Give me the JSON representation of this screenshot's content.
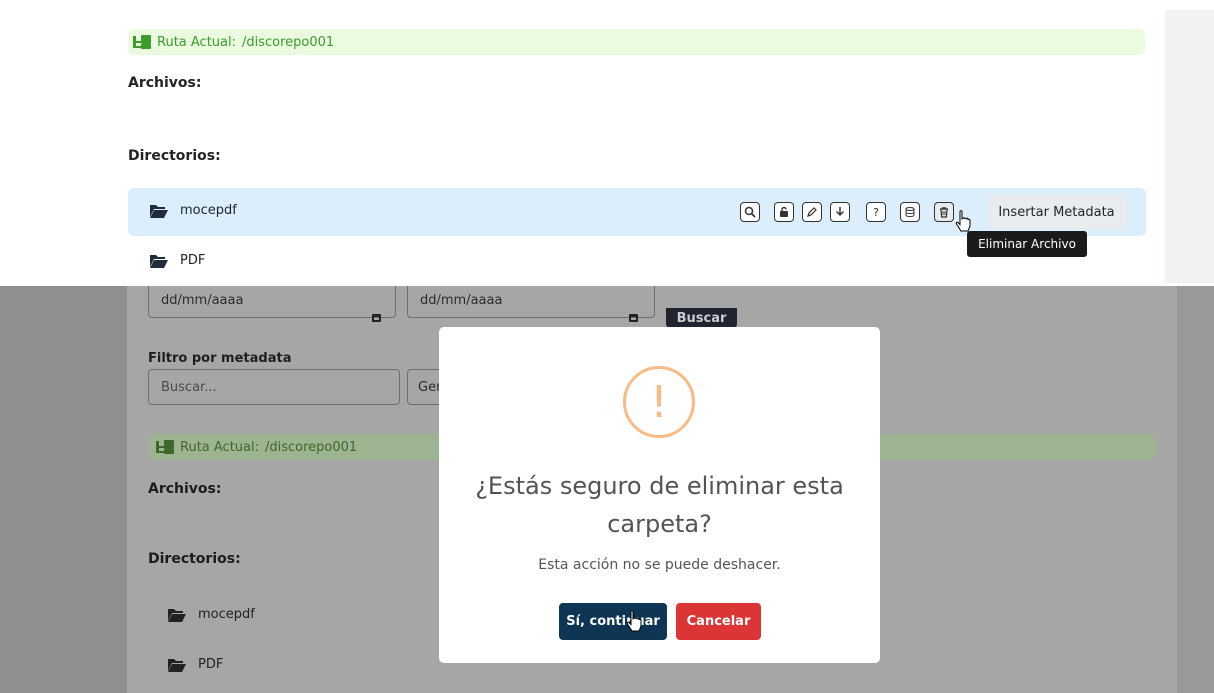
{
  "top": {
    "ruta_label": "Ruta Actual:",
    "ruta_path": "/discorepo001",
    "archivos_heading": "Archivos:",
    "directorios_heading": "Directorios:",
    "directories": [
      {
        "name": "mocepdf",
        "icon": "folder-open-icon"
      },
      {
        "name": "PDF",
        "icon": "folder-open-icon"
      }
    ],
    "actions": [
      {
        "icon": "search-file-icon"
      },
      {
        "icon": "lock-icon"
      },
      {
        "icon": "edit-icon"
      },
      {
        "icon": "download-icon"
      },
      {
        "icon": "help-icon"
      },
      {
        "icon": "database-icon"
      },
      {
        "icon": "trash-icon"
      }
    ],
    "insert_metadata_label": "Insertar Metadata",
    "tooltip": "Eliminar Archivo"
  },
  "bottom": {
    "date_from_placeholder": "dd/mm/aaaa",
    "date_to_placeholder": "dd/mm/aaaa",
    "buscar_label": "Buscar",
    "filter_label": "Filtro por metadata",
    "search_placeholder": "Buscar...",
    "select_partial": "Ger",
    "ruta_label": "Ruta Actual:",
    "ruta_path": "/discorepo001",
    "archivos_heading": "Archivos:",
    "directorios_heading": "Directorios:",
    "directories": [
      {
        "name": "mocepdf"
      },
      {
        "name": "PDF"
      }
    ]
  },
  "modal": {
    "icon": "warning-icon",
    "icon_glyph": "!",
    "title": "¿Estás seguro de eliminar esta carpeta?",
    "text": "Esta acción no se puede deshacer.",
    "confirm_label": "Sí, continuar",
    "cancel_label": "Cancelar"
  },
  "colors": {
    "confirm": "#0f3554",
    "cancel": "#dc3535",
    "warning": "#f8bb86",
    "ruta_bg": "#eafbdf",
    "row_highlight": "#dbeefb"
  }
}
